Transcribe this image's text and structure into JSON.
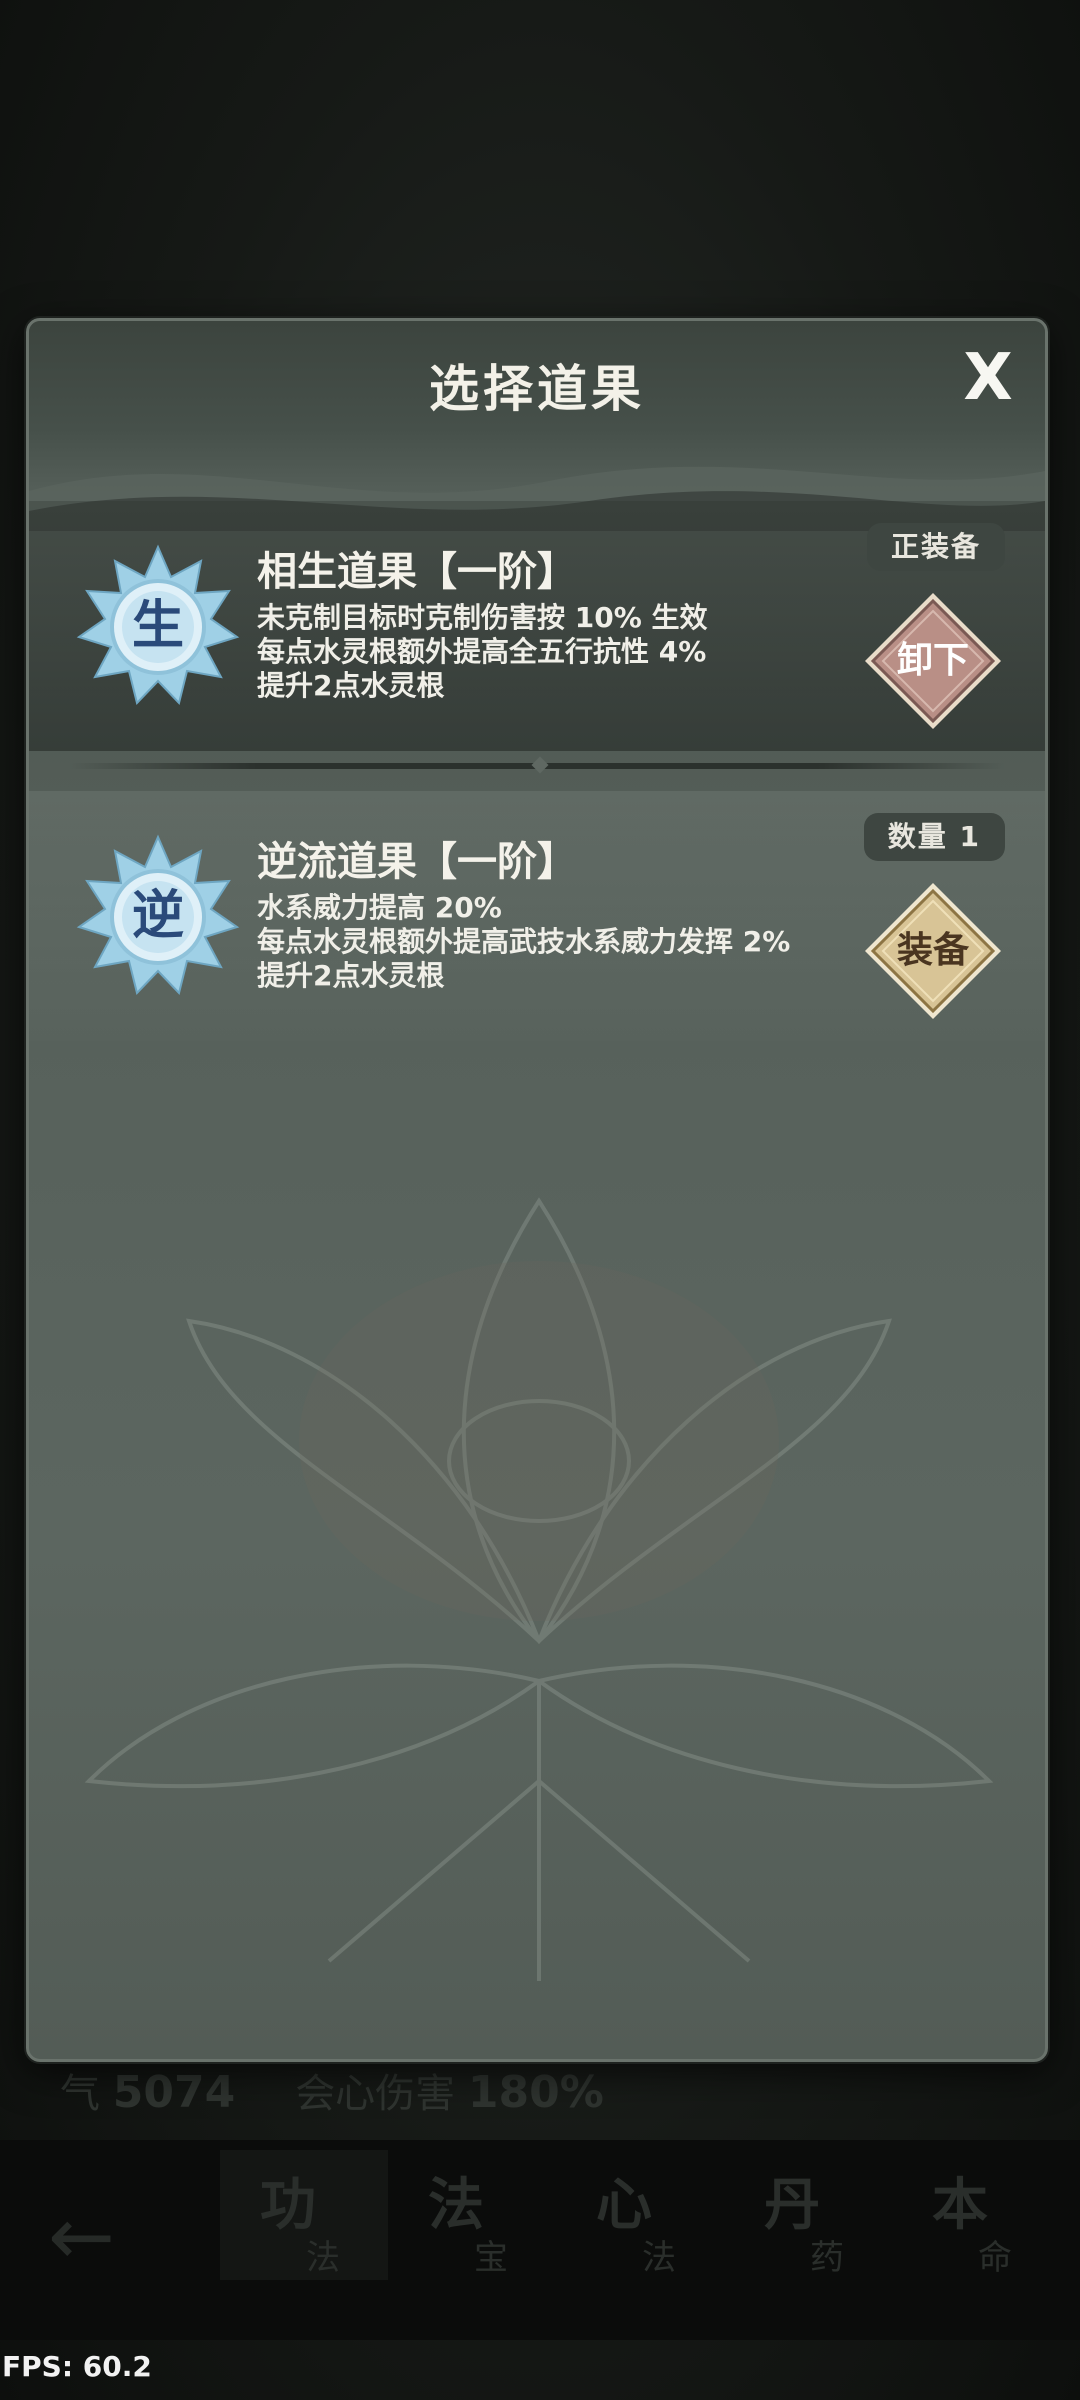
{
  "modal": {
    "title": "选择道果",
    "close_label": "X"
  },
  "items": [
    {
      "icon": "lotus-orb-icon",
      "glyph": "生",
      "name": "相生道果【一阶】",
      "status": "正装备",
      "lines": [
        "未克制目标时克制伤害按 10% 生效",
        "每点水灵根额外提高全五行抗性 4%",
        "提升2点水灵根"
      ],
      "action_label": "卸下"
    },
    {
      "icon": "lotus-orb-icon",
      "glyph": "逆",
      "name": "逆流道果【一阶】",
      "status": "数量 1",
      "lines": [
        "水系威力提高 20%",
        "每点水灵根额外提高武技水系威力发挥 2%",
        "提升2点水灵根"
      ],
      "action_label": "装备"
    }
  ],
  "background": {
    "stat_1_label": "气",
    "stat_1_value": "5074",
    "stat_2_label": "会心伤害",
    "stat_2_value": "180%",
    "tabs": [
      {
        "big": "功",
        "small": "法"
      },
      {
        "big": "法",
        "small": "宝"
      },
      {
        "big": "心",
        "small": "法"
      },
      {
        "big": "丹",
        "small": "药"
      },
      {
        "big": "本",
        "small": "命"
      }
    ]
  },
  "fps": "FPS: 60.2",
  "colors": {
    "unequip_button": "#b98f86",
    "equip_button": "#d8c496"
  }
}
